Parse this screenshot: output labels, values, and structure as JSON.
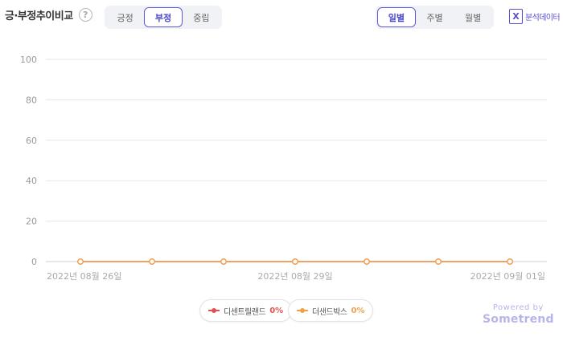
{
  "header": {
    "title": "긍·부정추이비교",
    "help_symbol": "?",
    "sentiment_tabs": [
      {
        "label": "긍정",
        "active": false
      },
      {
        "label": "부정",
        "active": true
      },
      {
        "label": "중립",
        "active": false
      }
    ],
    "period_tabs": [
      {
        "label": "일별",
        "active": true
      },
      {
        "label": "주별",
        "active": false
      },
      {
        "label": "월별",
        "active": false
      }
    ],
    "export_icon_letter": "X",
    "export_label": "분석데이터"
  },
  "colors": {
    "accent": "#5f5bd8",
    "grid": "#e6e6e6",
    "series_0": "#e05252",
    "series_1": "#f0a04b"
  },
  "chart_data": {
    "type": "line",
    "title": "",
    "xlabel": "",
    "ylabel": "",
    "ylim": [
      0,
      100
    ],
    "yticks": [
      0,
      20,
      40,
      60,
      80,
      100
    ],
    "grid": true,
    "legend_position": "bottom",
    "x": [
      "2022-08-26",
      "2022-08-27",
      "2022-08-28",
      "2022-08-29",
      "2022-08-30",
      "2022-08-31",
      "2022-09-01"
    ],
    "xtick_labels": [
      {
        "index": 0,
        "label": "2022년 08월 26일"
      },
      {
        "index": 3,
        "label": "2022년 08월 29일"
      },
      {
        "index": 6,
        "label": "2022년 09월 01일"
      }
    ],
    "series": [
      {
        "name": "디센트릴랜드",
        "percent_label": "0%",
        "color": "#e05252",
        "values": [
          0,
          0,
          0,
          0,
          0,
          0,
          0
        ]
      },
      {
        "name": "더샌드박스",
        "percent_label": "0%",
        "color": "#f0a04b",
        "values": [
          0,
          0,
          0,
          0,
          0,
          0,
          0
        ]
      }
    ]
  },
  "footer": {
    "powered_by": "Powered by",
    "brand": "Sometrend"
  }
}
